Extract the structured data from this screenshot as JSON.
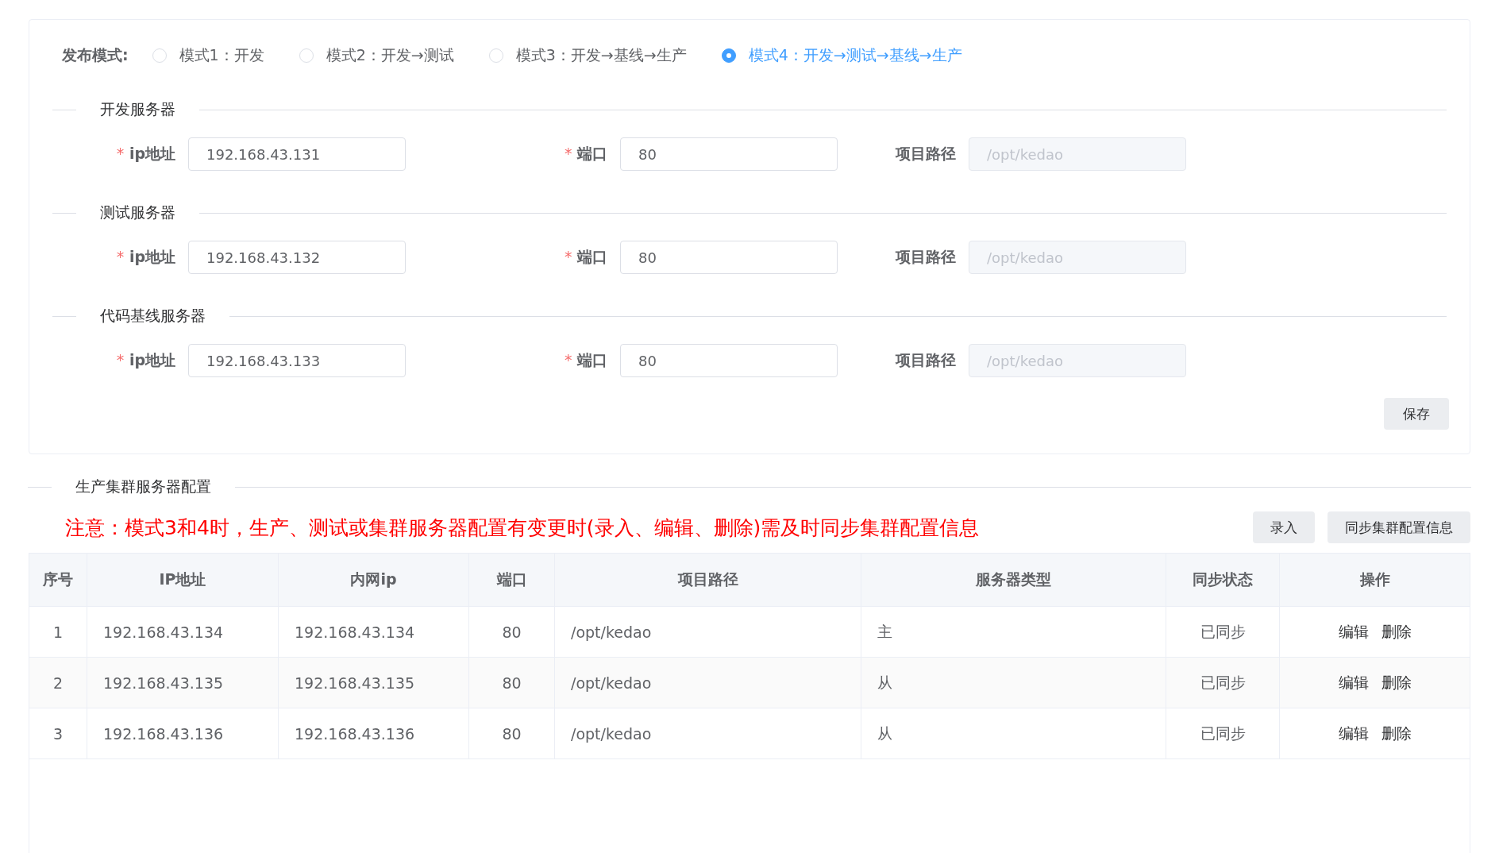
{
  "release_mode": {
    "label": "发布模式:",
    "options": [
      {
        "label": "模式1：开发",
        "selected": false
      },
      {
        "label": "模式2：开发→测试",
        "selected": false
      },
      {
        "label": "模式3：开发→基线→生产",
        "selected": false
      },
      {
        "label": "模式4：开发→测试→基线→生产",
        "selected": true
      }
    ]
  },
  "servers": [
    {
      "title": "开发服务器",
      "ip_label": "ip地址",
      "ip": "192.168.43.131",
      "port_label": "端口",
      "port": "80",
      "path_label": "项目路径",
      "path_placeholder": "/opt/kedao"
    },
    {
      "title": "测试服务器",
      "ip_label": "ip地址",
      "ip": "192.168.43.132",
      "port_label": "端口",
      "port": "80",
      "path_label": "项目路径",
      "path_placeholder": "/opt/kedao"
    },
    {
      "title": "代码基线服务器",
      "ip_label": "ip地址",
      "ip": "192.168.43.133",
      "port_label": "端口",
      "port": "80",
      "path_label": "项目路径",
      "path_placeholder": "/opt/kedao"
    }
  ],
  "required_mark": "*",
  "save_button": "保存",
  "cluster": {
    "title": "生产集群服务器配置",
    "notice": "注意：模式3和4时，生产、测试或集群服务器配置有变更时(录入、编辑、删除)需及时同步集群配置信息",
    "buttons": [
      "录入",
      "同步集群配置信息"
    ],
    "table": {
      "columns": [
        "序号",
        "IP地址",
        "内网ip",
        "端口",
        "项目路径",
        "服务器类型",
        "同步状态",
        "操作"
      ],
      "rows": [
        {
          "cells": [
            "1",
            "192.168.43.134",
            "192.168.43.134",
            "80",
            "/opt/kedao",
            "主",
            "已同步"
          ],
          "actions": [
            "编辑",
            "删除"
          ]
        },
        {
          "cells": [
            "2",
            "192.168.43.135",
            "192.168.43.135",
            "80",
            "/opt/kedao",
            "从",
            "已同步"
          ],
          "actions": [
            "编辑",
            "删除"
          ]
        },
        {
          "cells": [
            "3",
            "192.168.43.136",
            "192.168.43.136",
            "80",
            "/opt/kedao",
            "从",
            "已同步"
          ],
          "actions": [
            "编辑",
            "删除"
          ]
        }
      ]
    }
  }
}
